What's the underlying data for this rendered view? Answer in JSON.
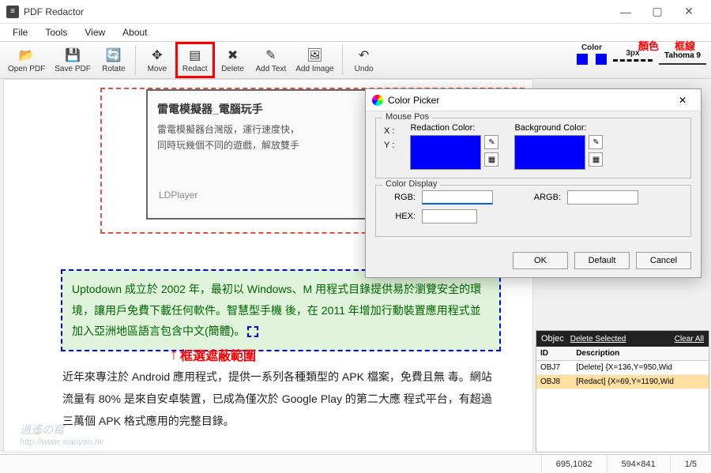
{
  "app": {
    "title": "PDF Redactor"
  },
  "menu": [
    "File",
    "Tools",
    "View",
    "About"
  ],
  "toolbar": {
    "open": "Open PDF",
    "save": "Save PDF",
    "rotate": "Rotate",
    "move": "Move",
    "redact": "Redact",
    "delete": "Delete",
    "addtext": "Add Text",
    "addimage": "Add Image",
    "undo": "Undo"
  },
  "right_tool": {
    "color_label": "Color",
    "border_label": "3px",
    "font_label": "Tahoma 9"
  },
  "annotations": {
    "color_zh": "顏色",
    "border_zh": "框線",
    "selection_zh": "框選遮蔽範圍"
  },
  "doc": {
    "ad_title": "雷電模擬器_電腦玩手",
    "ad_line1": "雷電模擬器台灣版，運行速度快，",
    "ad_line2": "同時玩幾個不同的遊戲，解放雙手",
    "ad_brand": "LDPlayer",
    "sel_text": "Uptodown 成立於 2002 年，最初以 Windows、M                                        用程式目錄提供易於瀏覽安全的環境，讓用戶免費下載任何軟件。智慧型手機   後，在 2011 年增加行動裝置應用程式並加入亞洲地區語言包含中文(簡體)。",
    "para2": "近年來專注於 Android 應用程式，提供一系列各種類型的 APK 檔案，免費且無   毒。網站流量有 80% 是來自安卓裝置，已成為僅次於 Google Play 的第二大應   程式平台，有超過三萬個 APK 格式應用的完整目錄。",
    "watermark_url": "http://www.xiaoyao.tw"
  },
  "dialog": {
    "title": "Color Picker",
    "mouse_pos": "Mouse Pos",
    "x": "X :",
    "y": "Y :",
    "redaction_color": "Redaction Color:",
    "background_color": "Background Color:",
    "color_display": "Color Display",
    "rgb": "RGB:",
    "argb": "ARGB:",
    "hex": "HEX:",
    "ok": "OK",
    "default": "Default",
    "cancel": "Cancel",
    "redaction_hex": "#0000ff",
    "background_hex": "#0000ff"
  },
  "objects": {
    "header": "Objec",
    "delete_sel": "Delete Selected",
    "clear_all": "Clear All",
    "col_id": "ID",
    "col_desc": "Description",
    "rows": [
      {
        "id": "OBJ7",
        "desc": "[Delete] {X=136,Y=950,Wid"
      },
      {
        "id": "OBJ8",
        "desc": "[Redact] {X=69,Y=1190,Wid"
      }
    ]
  },
  "status": {
    "coords": "695,1082",
    "pagesize": "594×841",
    "page": "1/5"
  }
}
